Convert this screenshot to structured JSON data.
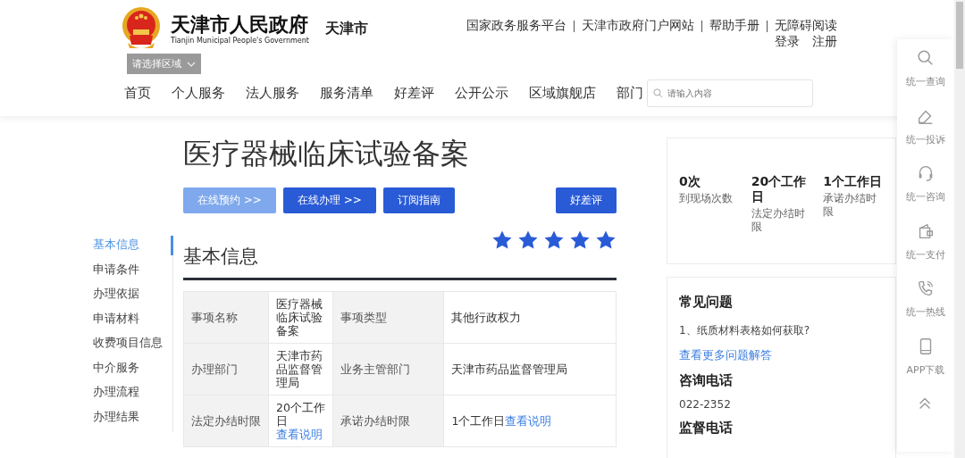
{
  "header": {
    "title": "天津市人民政府",
    "subtitle": "Tianjin Municipal People's Government",
    "city": "天津市",
    "top_links": [
      "国家政务服务平台",
      "天津市政府门户网站",
      "帮助手册",
      "无障碍阅读"
    ],
    "account_links": [
      "登录",
      "注册"
    ],
    "region_select": {
      "placeholder": "请选择区域"
    },
    "nav": [
      "首页",
      "个人服务",
      "法人服务",
      "服务清单",
      "好差评",
      "公开公示",
      "区域旗舰店",
      "部门"
    ],
    "search": {
      "placeholder": "请输入内容"
    }
  },
  "page_title": "医疗器械临床试验备案",
  "actions": [
    {
      "label": "在线预约 >>",
      "disabled": true
    },
    {
      "label": "在线办理 >>",
      "disabled": false
    },
    {
      "label": "订阅指南",
      "disabled": false
    }
  ],
  "rating_button": "好差评",
  "side_nav": [
    {
      "label": "基本信息",
      "selected": true
    },
    {
      "label": "申请条件",
      "selected": false
    },
    {
      "label": "办理依据",
      "selected": false
    },
    {
      "label": "申请材料",
      "selected": false
    },
    {
      "label": "收费项目信息",
      "selected": false
    },
    {
      "label": "中介服务",
      "selected": false
    },
    {
      "label": "办理流程",
      "selected": false
    },
    {
      "label": "办理结果",
      "selected": false
    }
  ],
  "section": {
    "title": "基本信息",
    "stars": 5
  },
  "table": {
    "rows": [
      [
        {
          "label": "事项名称",
          "value": "医疗器械临床试验备案"
        },
        {
          "label": "事项类型",
          "value": "其他行政权力"
        }
      ],
      [
        {
          "label": "办理部门",
          "value": "天津市药品监督管理局"
        },
        {
          "label": "业务主管部门",
          "value": "天津市药品监督管理局"
        }
      ],
      [
        {
          "label": "法定办结时限",
          "value": "20个工作日",
          "link": "查看说明"
        },
        {
          "label": "承诺办结时限",
          "value": "1个工作日",
          "link": "查看说明"
        }
      ]
    ]
  },
  "summary": [
    {
      "value": "0次",
      "label": "到现场次数"
    },
    {
      "value": "20个工作日",
      "label": "法定办结时限"
    },
    {
      "value": "1个工作日",
      "label": "承诺办结时限"
    }
  ],
  "faq": {
    "title": "常见问题",
    "question": "1、纸质材料表格如何获取?",
    "more_link": "查看更多问题解答",
    "phone_title": "咨询电话",
    "phone": "022-2352",
    "supervision_title": "监督电话"
  },
  "float_bar": [
    {
      "kind": "search",
      "label": "统一查询"
    },
    {
      "kind": "complaint",
      "label": "统一投诉"
    },
    {
      "kind": "headset",
      "label": "统一咨询"
    },
    {
      "kind": "wallet",
      "label": "统一支付"
    },
    {
      "kind": "phone",
      "label": "统一热线"
    },
    {
      "kind": "mobile",
      "label": "APP下载"
    },
    {
      "kind": "collapse"
    }
  ]
}
